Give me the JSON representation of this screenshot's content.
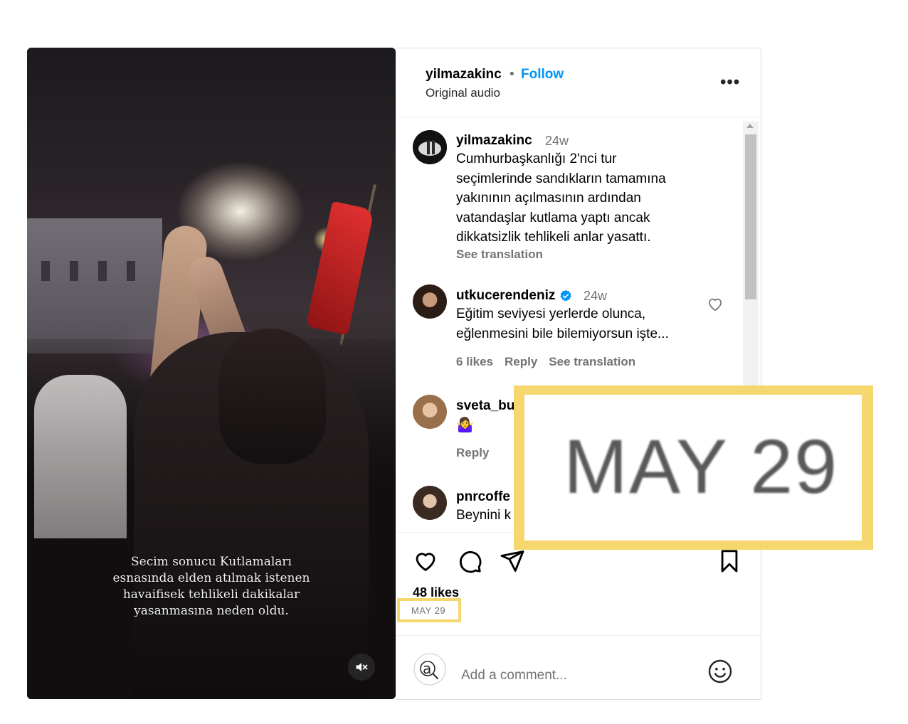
{
  "post": {
    "username": "yilmazakinc",
    "separator": "•",
    "follow_label": "Follow",
    "audio_label": "Original audio",
    "more_label": "•••"
  },
  "video": {
    "caption_lines": [
      "Secim sonucu Kutlamaları",
      "esnasında elden atılmak istenen",
      "havaifisek tehlikeli dakikalar",
      "yasanmasına neden oldu."
    ],
    "muted": true
  },
  "comments": [
    {
      "username": "yilmazakinc",
      "time": "24w",
      "lines": [
        "Cumhurbaşkanlığı 2'nci tur",
        "seçimlerinde sandıkların tamamına",
        "yakınının açılmasının ardından",
        "vatandaşlar kutlama yaptı ancak",
        "dikkatsizlik tehlikeli anlar yasattı."
      ],
      "see_translation": "See translation"
    },
    {
      "username": "utkucerendeniz",
      "time": "24w",
      "verified": true,
      "lines": [
        "Eğitim seviyesi yerlerde olunca,",
        "eğlenmesini bile bilemiyorsun işte..."
      ],
      "likes": "6 likes",
      "reply": "Reply",
      "see_translation": "See translation"
    },
    {
      "username": "sveta_bu",
      "emoji": "🤷‍♀️",
      "reply": "Reply"
    },
    {
      "username": "pnrcoffe",
      "lines": [
        "Beynini k"
      ]
    }
  ],
  "footer": {
    "likes": "48 likes",
    "date": "MAY 29",
    "add_comment_placeholder": "Add a comment..."
  },
  "zoom": {
    "text": "MAY 29",
    "highlight_color": "#f5d76e"
  },
  "colors": {
    "link_blue": "#0095f6",
    "verified_blue": "#0095f6",
    "secondary_text": "#737373"
  }
}
